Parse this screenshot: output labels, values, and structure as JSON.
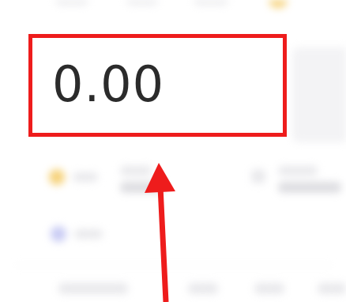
{
  "balance": {
    "value": "0.00"
  },
  "annotation": {
    "highlight_color": "#ee1c1c",
    "arrow_color": "#ee1c1c",
    "arrow_direction": "up"
  },
  "background": {
    "style": "blurred"
  }
}
